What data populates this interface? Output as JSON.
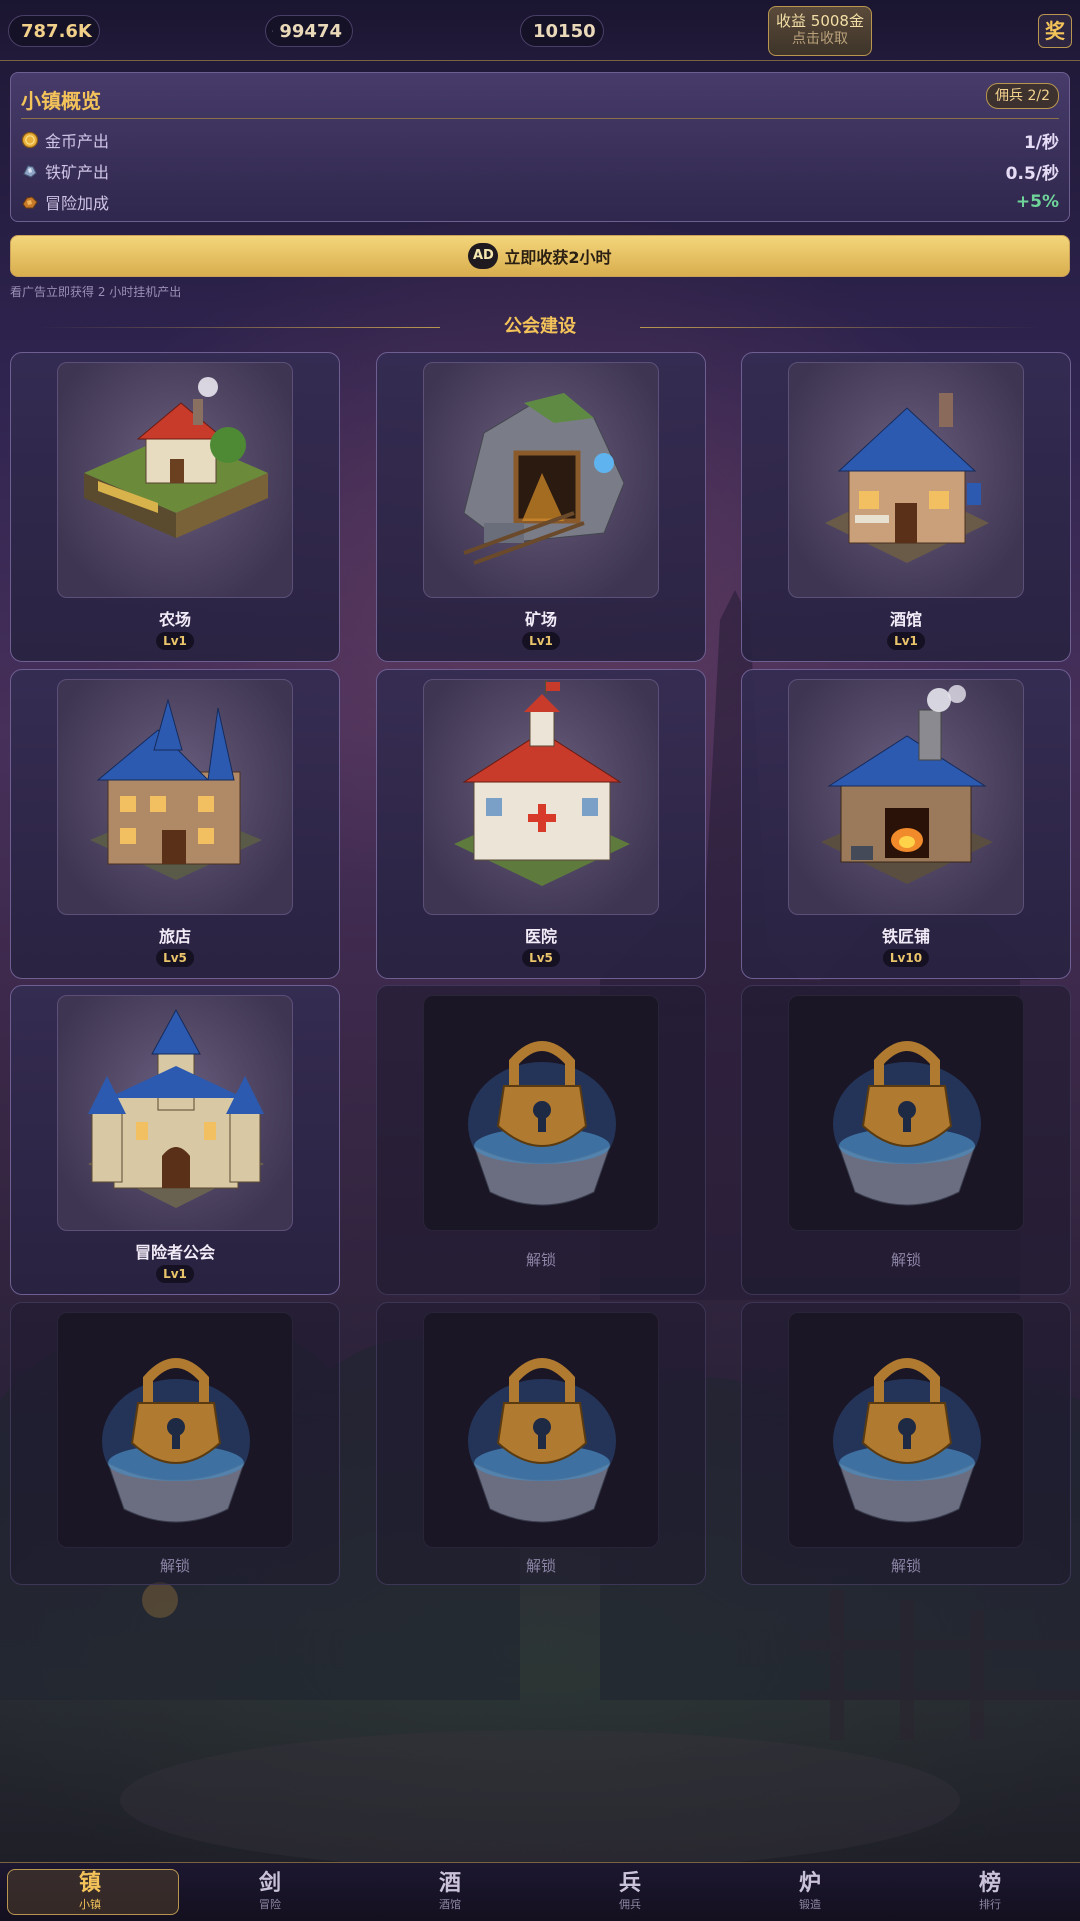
{
  "resources": {
    "gold": "787.6K",
    "iron": "99474",
    "gem": "10150"
  },
  "claim": {
    "line1": "收益 5008金",
    "line2": "点击收取"
  },
  "reward_label": "奖",
  "overview": {
    "title": "小镇概览",
    "mercenary_badge": "佣兵 2/2",
    "stats": [
      {
        "label": "金币产出",
        "value": "1/秒",
        "icon": "gold-coin-icon"
      },
      {
        "label": "铁矿产出",
        "value": "0.5/秒",
        "icon": "iron-ore-icon"
      },
      {
        "label": "冒险加成",
        "value": "+5%",
        "icon": "adventure-bonus-icon",
        "color": "#6fd49a"
      }
    ]
  },
  "ad": {
    "badge": "AD",
    "label": "立即收获2小时",
    "hint": "看广告立即获得 2 小时挂机产出"
  },
  "section_title": "公会建设",
  "buildings": [
    {
      "name": "农场",
      "level": "Lv1",
      "locked": false,
      "icon": "farm-icon"
    },
    {
      "name": "矿场",
      "level": "Lv1",
      "locked": false,
      "icon": "mine-icon"
    },
    {
      "name": "酒馆",
      "level": "Lv1",
      "locked": false,
      "icon": "tavern-icon"
    },
    {
      "name": "旅店",
      "level": "Lv5",
      "locked": false,
      "icon": "inn-icon"
    },
    {
      "name": "医院",
      "level": "Lv5",
      "locked": false,
      "icon": "hospital-icon"
    },
    {
      "name": "铁匠铺",
      "level": "Lv10",
      "locked": false,
      "icon": "blacksmith-icon"
    },
    {
      "name": "冒险者公会",
      "level": "Lv1",
      "locked": false,
      "icon": "guild-castle-icon"
    },
    {
      "name": "解锁",
      "locked": true,
      "icon": "lock-icon"
    },
    {
      "name": "解锁",
      "locked": true,
      "icon": "lock-icon"
    },
    {
      "name": "解锁",
      "locked": true,
      "icon": "lock-icon"
    },
    {
      "name": "解锁",
      "locked": true,
      "icon": "lock-icon"
    },
    {
      "name": "解锁",
      "locked": true,
      "icon": "lock-icon"
    }
  ],
  "nav": [
    {
      "char": "镇",
      "label": "小镇",
      "active": true
    },
    {
      "char": "剑",
      "label": "冒险",
      "active": false
    },
    {
      "char": "酒",
      "label": "酒馆",
      "active": false
    },
    {
      "char": "兵",
      "label": "佣兵",
      "active": false
    },
    {
      "char": "炉",
      "label": "锻造",
      "active": false
    },
    {
      "char": "榜",
      "label": "排行",
      "active": false
    }
  ],
  "colors": {
    "accent_gold": "#f3c35a",
    "panel_border": "#6e5f92",
    "positive_green": "#6fd49a"
  }
}
